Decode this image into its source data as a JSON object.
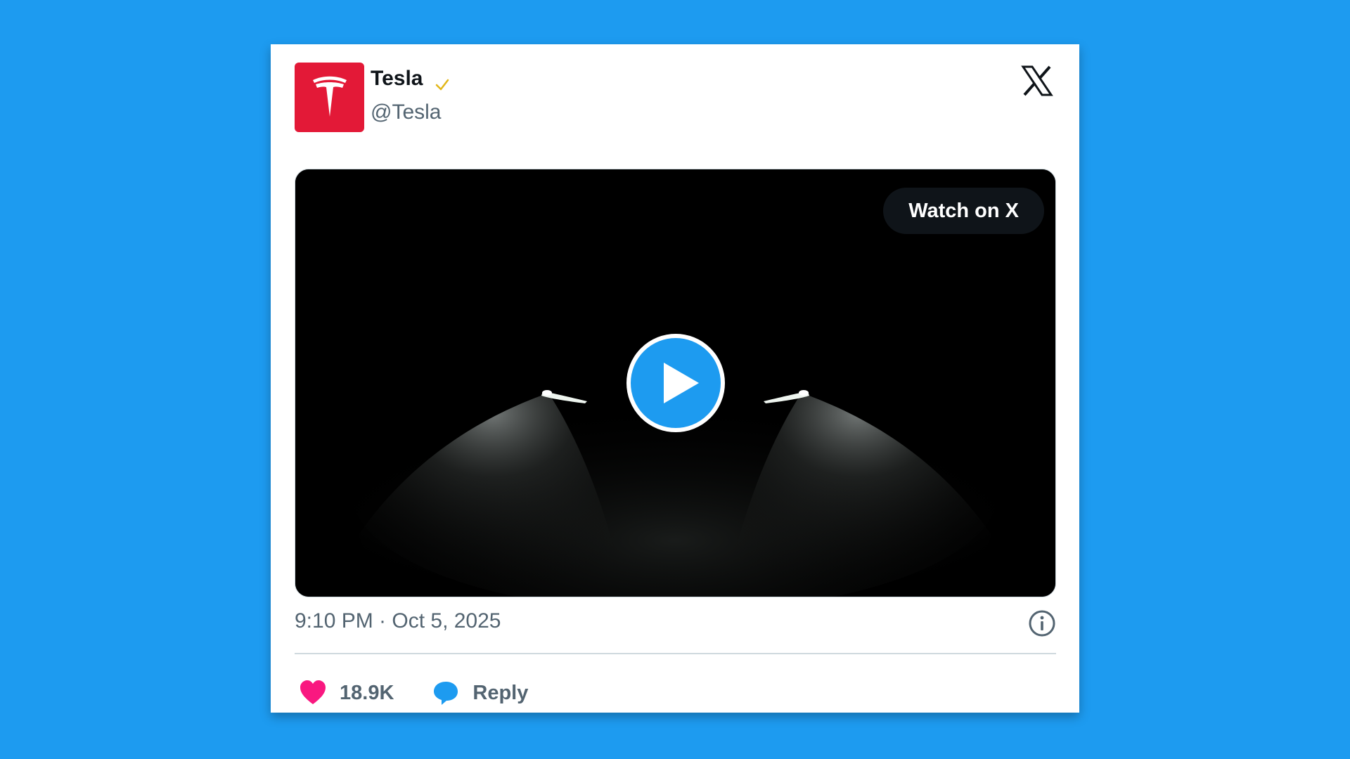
{
  "tweet": {
    "author_name": "Tesla",
    "author_handle": "@Tesla",
    "verified_icon": "verified-check-icon",
    "brand_icon": "x-logo-icon",
    "avatar_icon": "tesla-logo-icon",
    "timestamp": "9:10 PM · Oct 5, 2025",
    "info_icon": "info-icon"
  },
  "media": {
    "watch_label": "Watch on X",
    "play_icon": "play-icon"
  },
  "actions": {
    "like_icon": "heart-icon",
    "like_count": "18.9K",
    "reply_icon": "speech-bubble-icon",
    "reply_label": "Reply"
  },
  "colors": {
    "background": "#1d9bf0",
    "avatar": "#e31937",
    "heart": "#f91880",
    "reply": "#1d9bf0",
    "verified": "#e2b719"
  }
}
